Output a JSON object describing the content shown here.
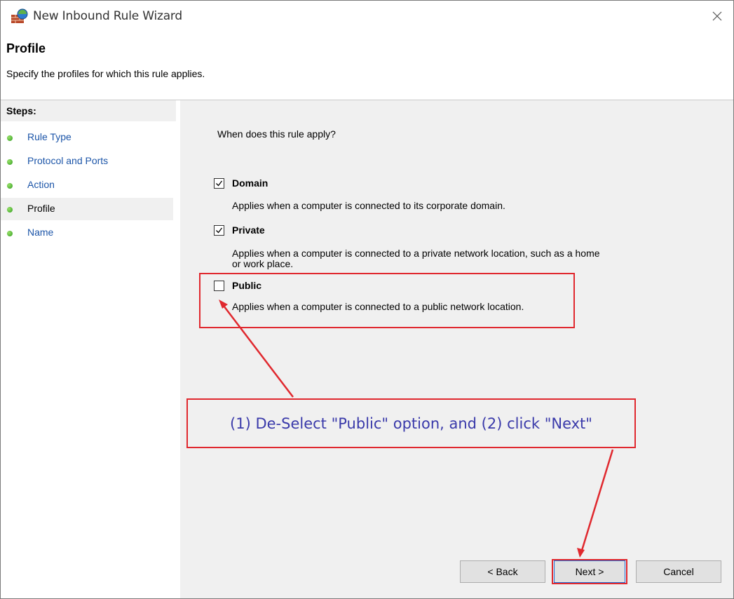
{
  "window": {
    "title": "New Inbound Rule Wizard",
    "app_icon": "firewall-icon",
    "close_icon": "close-icon"
  },
  "header": {
    "title": "Profile",
    "subtitle": "Specify the profiles for which this rule applies."
  },
  "sidebar": {
    "heading": "Steps:",
    "items": [
      {
        "label": "Rule Type",
        "active": false
      },
      {
        "label": "Protocol and Ports",
        "active": false
      },
      {
        "label": "Action",
        "active": false
      },
      {
        "label": "Profile",
        "active": true
      },
      {
        "label": "Name",
        "active": false
      }
    ]
  },
  "content": {
    "question": "When does this rule apply?",
    "options": [
      {
        "label": "Domain",
        "checked": true,
        "description": "Applies when a computer is connected to its corporate domain."
      },
      {
        "label": "Private",
        "checked": true,
        "description_line1": "Applies when a computer is connected to a private network location, such as a home",
        "description_line2": "or work place."
      },
      {
        "label": "Public",
        "checked": false,
        "description": "Applies when a computer is connected to a public network location."
      }
    ]
  },
  "annotation": {
    "callout": "(1) De-Select \"Public\" option, and (2) click \"Next\"",
    "color": "#e0282e",
    "text_color": "#3a3aaa"
  },
  "buttons": {
    "back": "< Back",
    "next": "Next >",
    "cancel": "Cancel"
  }
}
